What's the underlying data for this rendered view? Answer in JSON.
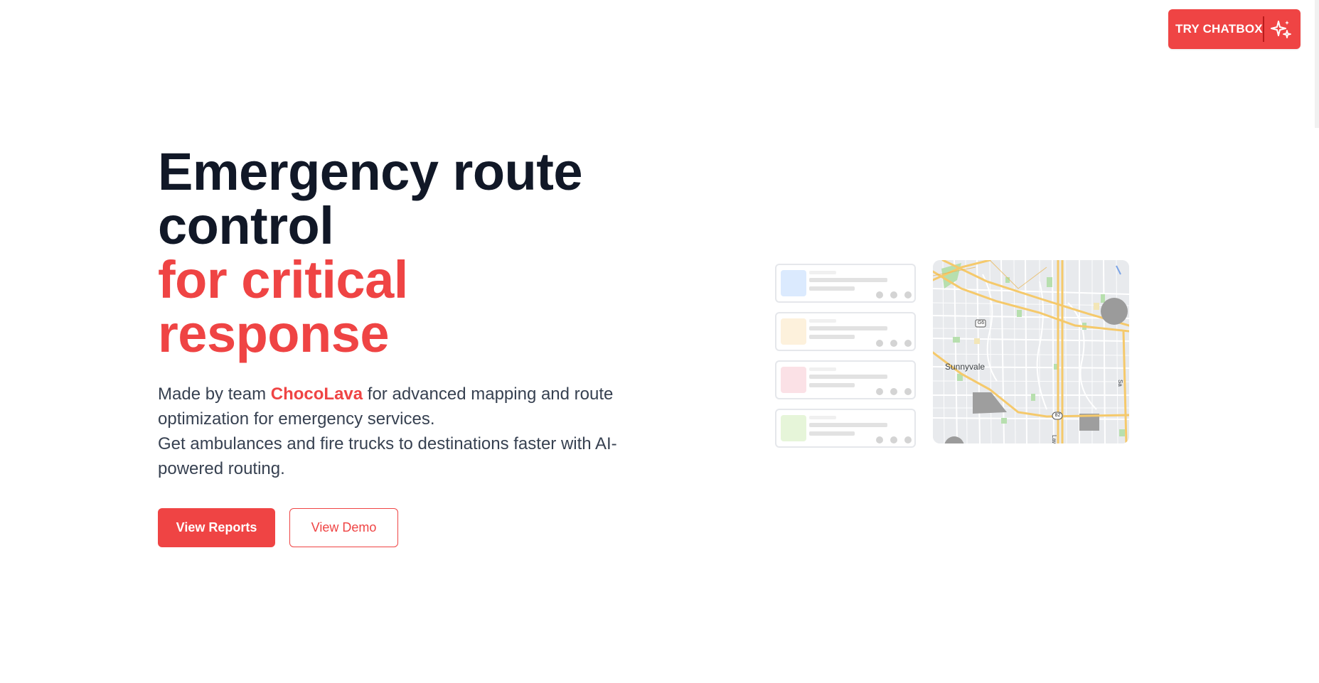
{
  "header": {
    "cta_label": "TRY CHATBOX",
    "cta_icon": "sparkles-icon"
  },
  "hero": {
    "title_line1": "Emergency route",
    "title_line2": "control",
    "title_accent_line1": "for critical",
    "title_accent_line2": "response",
    "desc_prefix": "Made by team ",
    "desc_brand": "ChocoLava",
    "desc_suffix": " for advanced mapping and route optimization for emergency services.",
    "desc_line2": "Get ambulances and fire trucks to destinations faster with AI-powered routing.",
    "primary_button": "View Reports",
    "secondary_button": "View Demo"
  },
  "illustration": {
    "cards": [
      {
        "swatch": "#dbeafe"
      },
      {
        "swatch": "#fdf1dc"
      },
      {
        "swatch": "#fbe1e6"
      },
      {
        "swatch": "#e6f5d9"
      }
    ],
    "map": {
      "city_label": "Sunnyvale",
      "shield_g6": "G6",
      "shield_82": "82",
      "edge_label_law": "Law",
      "edge_label_sa": "Sa"
    }
  },
  "colors": {
    "accent": "#ef4444",
    "heading": "#111827",
    "body_text": "#374151"
  }
}
